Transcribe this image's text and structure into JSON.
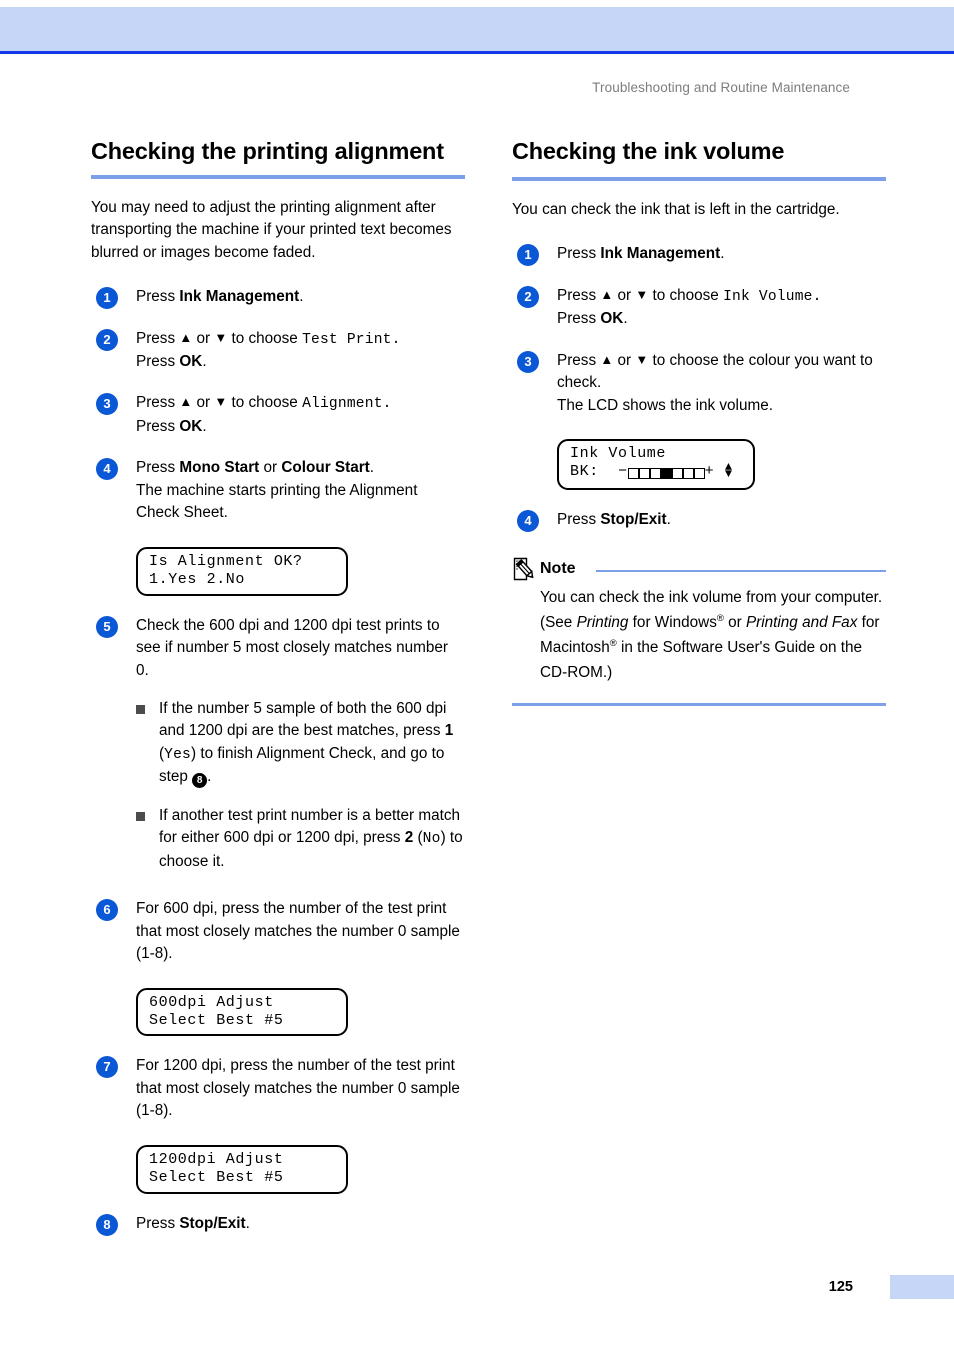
{
  "header": {
    "running_head": "Troubleshooting and Routine Maintenance"
  },
  "footer": {
    "page_number": "125"
  },
  "colors": {
    "band": "#c6d6f7",
    "top_rule": "#1338e8",
    "heading_rule": "#7d9fe8",
    "step_circle": "#0b58d6"
  },
  "left_column": {
    "title": "Checking the printing alignment",
    "intro": "You may need to adjust the printing alignment after transporting the machine if your printed text becomes blurred or images become faded.",
    "steps": {
      "s1": {
        "num": "1",
        "pre": "Press ",
        "bold": "Ink Management",
        "post": "."
      },
      "s2": {
        "num": "2",
        "line1_pre": "Press ",
        "up": "▲",
        "or": " or ",
        "down": "▼",
        "line1_mid": " to choose ",
        "mono": "Test Print.",
        "line2_pre": "Press ",
        "line2_bold": "OK",
        "line2_post": "."
      },
      "s3": {
        "num": "3",
        "line1_pre": "Press ",
        "line1_mid": " to choose ",
        "mono": "Alignment.",
        "line2_pre": "Press ",
        "line2_bold": "OK",
        "line2_post": "."
      },
      "s4": {
        "num": "4",
        "pre": "Press ",
        "bold1": "Mono Start",
        "mid": " or ",
        "bold2": "Colour Start",
        "post": ".",
        "line2": "The machine starts printing the Alignment Check Sheet.",
        "lcd_line1": "Is Alignment OK?",
        "lcd_line2": "1.Yes 2.No"
      },
      "s5": {
        "num": "5",
        "text": "Check the 600 dpi and 1200 dpi test prints to see if number 5 most closely matches number 0.",
        "bullet1_a": "If the number 5 sample of both the 600 dpi and 1200 dpi are the best matches, press ",
        "bullet1_bold": "1",
        "bullet1_b": " (",
        "bullet1_mono": "Yes",
        "bullet1_c": ") to finish Alignment Check, and go to step ",
        "bullet1_stepref": "8",
        "bullet1_d": ".",
        "bullet2_a": "If another test print number is a better match for either 600 dpi or 1200 dpi, press ",
        "bullet2_bold": "2",
        "bullet2_b": " (",
        "bullet2_mono": "No",
        "bullet2_c": ") to choose it."
      },
      "s6": {
        "num": "6",
        "text": "For 600 dpi, press the number of the test print that most closely matches the number 0 sample (1-8).",
        "lcd_line1": "600dpi Adjust",
        "lcd_line2": "Select Best #5"
      },
      "s7": {
        "num": "7",
        "text": "For 1200 dpi, press the number of the test print that most closely matches the number 0 sample (1-8).",
        "lcd_line1": "1200dpi Adjust",
        "lcd_line2": "Select Best #5"
      },
      "s8": {
        "num": "8",
        "pre": "Press ",
        "bold": "Stop/Exit",
        "post": "."
      }
    }
  },
  "right_column": {
    "title": "Checking the ink volume",
    "intro": "You can check the ink that is left in the cartridge.",
    "steps": {
      "s1": {
        "num": "1",
        "pre": "Press ",
        "bold": "Ink Management",
        "post": "."
      },
      "s2": {
        "num": "2",
        "line1_pre": "Press ",
        "line1_mid": " to choose ",
        "mono": "Ink Volume.",
        "line2_pre": "Press ",
        "line2_bold": "OK",
        "line2_post": "."
      },
      "s3": {
        "num": "3",
        "line1_pre": "Press ",
        "line1_mid": " to choose the colour you want to check.",
        "line2": "The LCD shows the ink volume.",
        "lcd_line1": "Ink Volume",
        "lcd_label": "BK:",
        "lcd_minus": "−",
        "lcd_plus": "+",
        "lcd_segments_total": 7,
        "lcd_segment_filled_index": 4
      },
      "s4": {
        "num": "4",
        "pre": "Press ",
        "bold": "Stop/Exit",
        "post": "."
      }
    },
    "note": {
      "label": "Note",
      "part1": "You can check the ink volume from your computer. (See ",
      "italic1": "Printing",
      "part2": " for Windows",
      "sup1": "®",
      "part3": " or ",
      "italic2": "Printing and Fax",
      "part4": " for Macintosh",
      "sup2": "®",
      "part5": " in the Software User's Guide on the CD-ROM.)"
    }
  },
  "glyphs": {
    "up_triangle": "▲",
    "down_triangle": "▼"
  }
}
